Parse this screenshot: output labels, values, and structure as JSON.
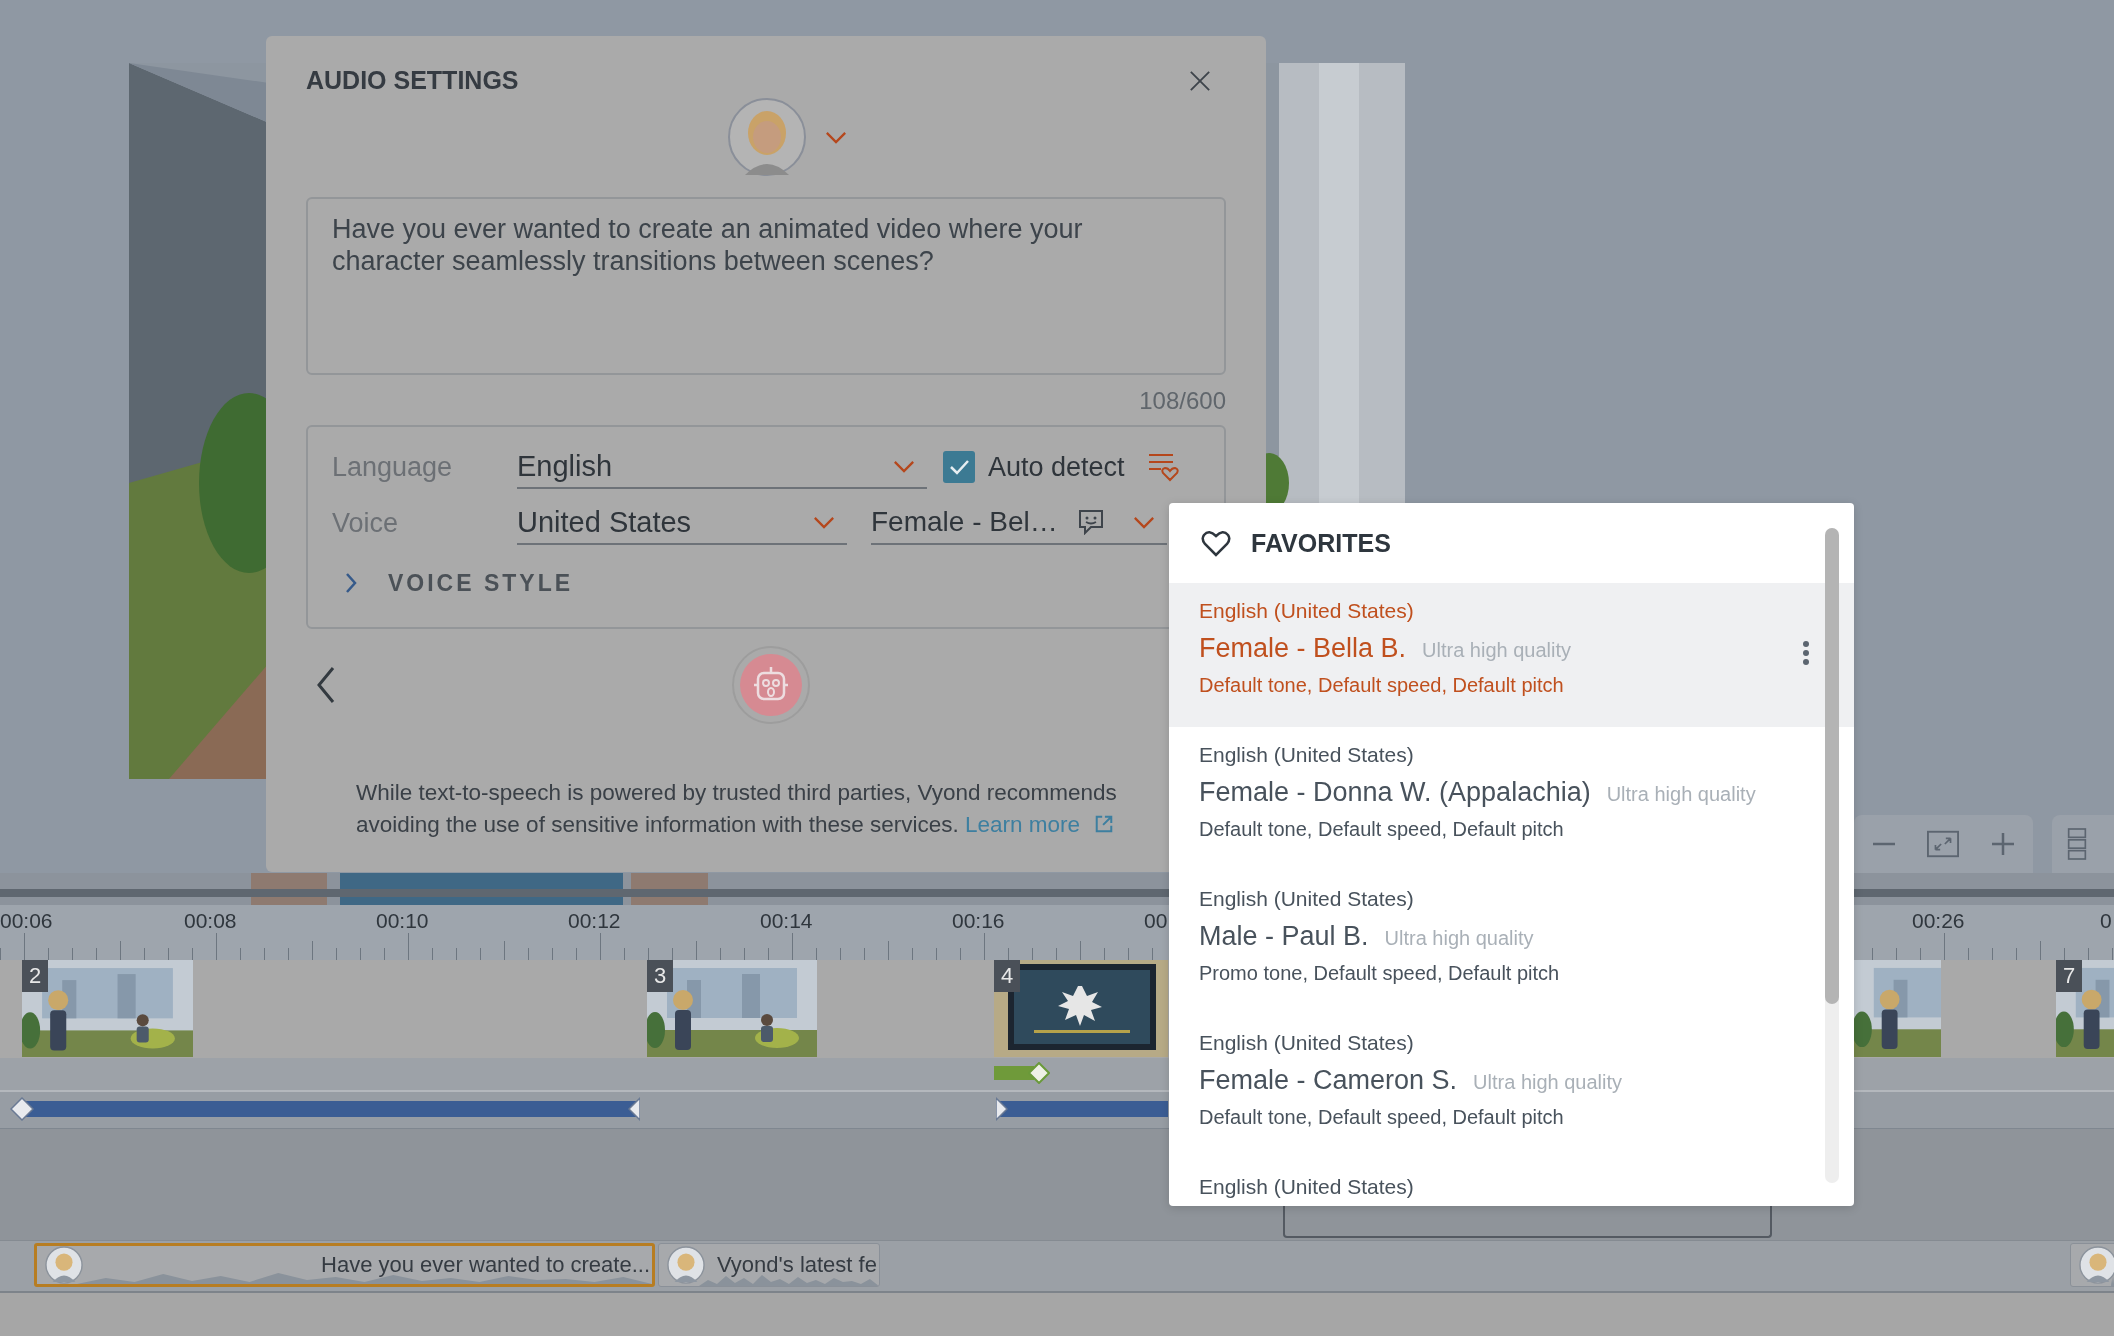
{
  "dialog": {
    "title": "AUDIO SETTINGS",
    "script": "Have you ever wanted to create an animated video where your character seamlessly transitions between scenes?",
    "char_count": "108/600",
    "language": {
      "label": "Language",
      "value": "English"
    },
    "auto_detect": {
      "label": "Auto detect",
      "checked": true
    },
    "voice": {
      "label": "Voice",
      "region": "United States",
      "name": "Female - Bel…"
    },
    "voice_style": {
      "label": "VOICE STYLE",
      "expanded": false
    },
    "disclaimer": {
      "text": "While text-to-speech is powered by trusted third parties, Vyond recommends avoiding the use of sensitive information with these services.",
      "link": "Learn more"
    }
  },
  "favorites": {
    "title": "FAVORITES",
    "items": [
      {
        "language": "English (United States)",
        "name": "Female - Bella B.",
        "quality": "Ultra high quality",
        "settings": "Default tone, Default speed, Default pitch",
        "selected": true
      },
      {
        "language": "English (United States)",
        "name": "Female - Donna W. (Appalachia)",
        "quality": "Ultra high quality",
        "settings": "Default tone, Default speed, Default pitch",
        "selected": false
      },
      {
        "language": "English (United States)",
        "name": "Male - Paul B.",
        "quality": "Ultra high quality",
        "settings": "Promo tone, Default speed, Default pitch",
        "selected": false
      },
      {
        "language": "English (United States)",
        "name": "Female - Cameron S.",
        "quality": "Ultra high quality",
        "settings": "Default tone, Default speed, Default pitch",
        "selected": false
      },
      {
        "language": "English (United States)",
        "selected": false
      }
    ]
  },
  "timeline": {
    "ticks": [
      "00:06",
      "00:08",
      "00:10",
      "00:12",
      "00:14",
      "00:16",
      "00",
      "00:26",
      "0"
    ],
    "scenes": [
      {
        "kind": "office",
        "number": "2"
      },
      {
        "kind": "office",
        "number": "3"
      },
      {
        "kind": "screen",
        "number": "4"
      },
      {
        "kind": "office"
      },
      {
        "kind": "office",
        "number": "7"
      }
    ],
    "audio_clips": [
      {
        "text": "Have you ever wanted to create...",
        "selected": true
      },
      {
        "text": "Vyond's latest fe",
        "selected": false
      },
      {
        "selected": false
      }
    ]
  }
}
